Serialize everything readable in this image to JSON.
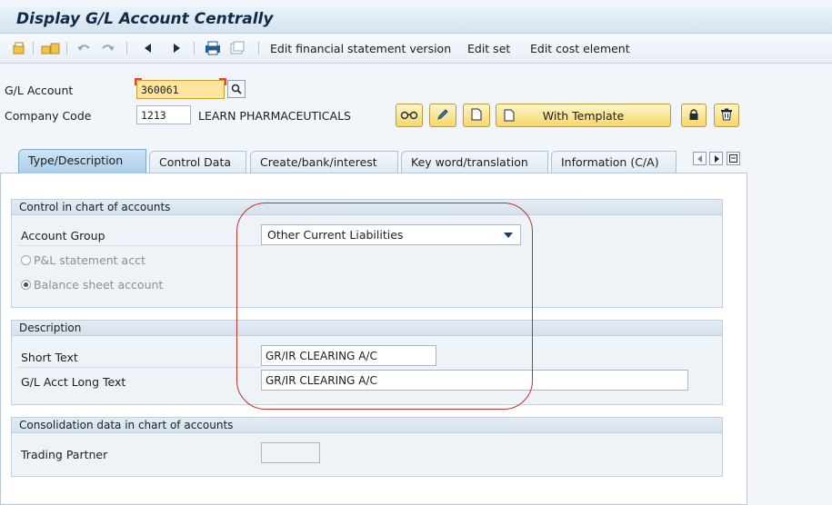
{
  "window": {
    "title": "Display G/L Account Centrally"
  },
  "toolbar": {
    "links": [
      "Edit financial statement version",
      "Edit set",
      "Edit cost element"
    ],
    "icons": [
      "other-object-icon",
      "where-used-icon",
      "undo-icon",
      "redo-icon",
      "previous-icon",
      "next-icon",
      "print-icon",
      "pages-icon"
    ]
  },
  "header": {
    "gl_account_label": "G/L Account",
    "gl_account_value": "360061",
    "company_code_label": "Company Code",
    "company_code_value": "1213",
    "company_name": "LEARN PHARMACEUTICALS",
    "with_template_label": "With Template"
  },
  "tabs": [
    {
      "label": "Type/Description",
      "active": true
    },
    {
      "label": "Control Data",
      "active": false
    },
    {
      "label": "Create/bank/interest",
      "active": false
    },
    {
      "label": "Key word/translation",
      "active": false
    },
    {
      "label": "Information (C/A)",
      "active": false
    }
  ],
  "control_group": {
    "title": "Control in chart of accounts",
    "account_group_label": "Account Group",
    "account_group_value": "Other Current Liabilities",
    "pl_label": "P&L statement acct",
    "bs_label": "Balance sheet account",
    "selected": "bs"
  },
  "description_group": {
    "title": "Description",
    "short_text_label": "Short Text",
    "short_text_value": "GR/IR CLEARING A/C",
    "long_text_label": "G/L Acct Long Text",
    "long_text_value": "GR/IR CLEARING A/C"
  },
  "consolidation_group": {
    "title": "Consolidation data in chart of accounts",
    "trading_partner_label": "Trading Partner",
    "trading_partner_value": ""
  },
  "colors": {
    "accent": "#0f2b4a",
    "button": "#f6d66b",
    "highlight": "#c4302b"
  }
}
